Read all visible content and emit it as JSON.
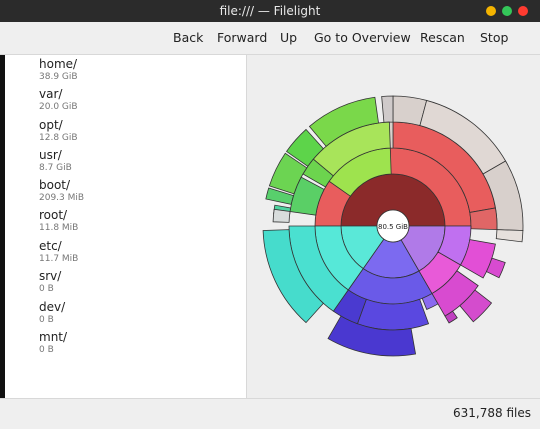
{
  "window": {
    "title": "file:/// — Filelight"
  },
  "toolbar": {
    "back": "Back",
    "forward": "Forward",
    "up": "Up",
    "overview": "Go to Overview",
    "rescan": "Rescan",
    "stop": "Stop"
  },
  "sidebar": {
    "items": [
      {
        "name": "home/",
        "size": "38.9 GiB"
      },
      {
        "name": "var/",
        "size": "20.0 GiB"
      },
      {
        "name": "opt/",
        "size": "12.8 GiB"
      },
      {
        "name": "usr/",
        "size": "8.7 GiB"
      },
      {
        "name": "boot/",
        "size": "209.3 MiB"
      },
      {
        "name": "root/",
        "size": "11.8 MiB"
      },
      {
        "name": "etc/",
        "size": "11.7 MiB"
      },
      {
        "name": "srv/",
        "size": "0 B"
      },
      {
        "name": "dev/",
        "size": "0 B"
      },
      {
        "name": "mnt/",
        "size": "0 B"
      }
    ]
  },
  "chart": {
    "center_label": "80.5 GiB"
  },
  "status": {
    "files": "631,788 files"
  },
  "colors": {
    "home": "#e85d5d",
    "var": "#a8e45a",
    "opt": "#56e8d8",
    "usr": "#6a5ae8",
    "boot": "#e85ad8"
  }
}
